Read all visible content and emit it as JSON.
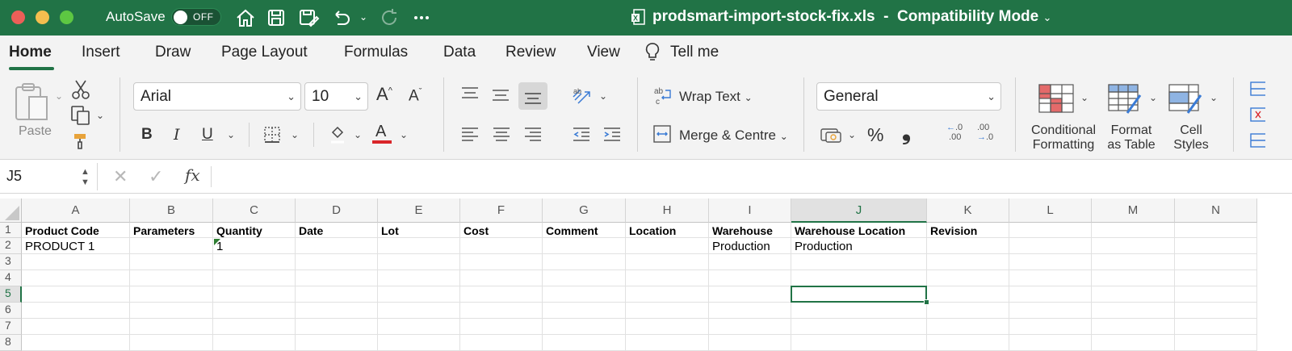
{
  "titlebar": {
    "autosave_label": "AutoSave",
    "toggle_state": "OFF",
    "doc_title": "prodsmart-import-stock-fix.xls",
    "separator": "-",
    "mode": "Compatibility Mode",
    "color": "#217346"
  },
  "tabs": [
    {
      "label": "Home",
      "active": true
    },
    {
      "label": "Insert"
    },
    {
      "label": "Draw"
    },
    {
      "label": "Page Layout"
    },
    {
      "label": "Formulas"
    },
    {
      "label": "Data"
    },
    {
      "label": "Review"
    },
    {
      "label": "View"
    },
    {
      "label": "Tell me"
    }
  ],
  "ribbon": {
    "paste_label": "Paste",
    "font_name": "Arial",
    "font_size": "10",
    "bold": "B",
    "italic": "I",
    "underline": "U",
    "wrap_text": "Wrap Text",
    "merge_centre": "Merge & Centre",
    "number_format": "General",
    "percent": "%",
    "comma": "❟",
    "conditional_formatting": [
      "Conditional",
      "Formatting"
    ],
    "format_as_table": [
      "Format",
      "as Table"
    ],
    "cell_styles": [
      "Cell",
      "Styles"
    ]
  },
  "formula_bar": {
    "name_box": "J5",
    "fx": "fx",
    "content": ""
  },
  "grid": {
    "columns": [
      "A",
      "B",
      "C",
      "D",
      "E",
      "F",
      "G",
      "H",
      "I",
      "J",
      "K",
      "L",
      "M",
      "N"
    ],
    "selected_column": "J",
    "rows": [
      "1",
      "2",
      "3",
      "4",
      "5",
      "6",
      "7",
      "8"
    ],
    "selected_row": "5",
    "row1": [
      "Product Code",
      "Parameters",
      "Quantity",
      "Date",
      "Lot",
      "Cost",
      "Comment",
      "Location",
      "Warehouse",
      "Warehouse Location",
      "Revision",
      "",
      "",
      ""
    ],
    "row2": [
      "PRODUCT 1",
      "",
      "1",
      "",
      "",
      "",
      "",
      "",
      "Production",
      "Production",
      "",
      "",
      "",
      ""
    ]
  }
}
